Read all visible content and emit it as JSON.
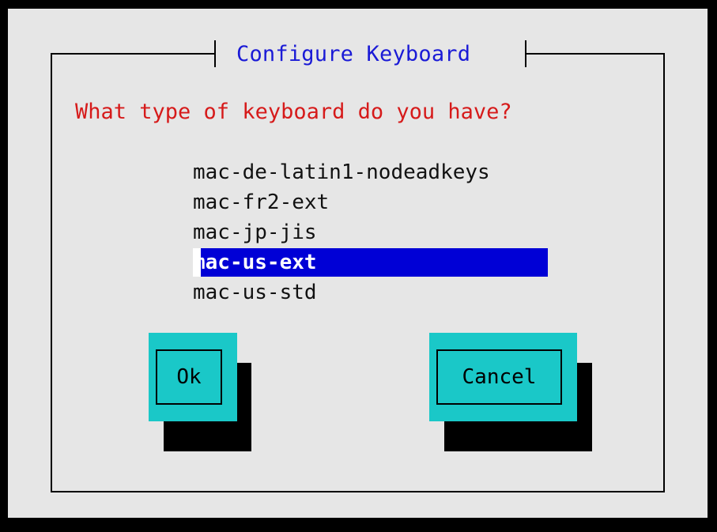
{
  "dialog": {
    "title": "Configure Keyboard",
    "prompt": "What type of keyboard do you have?"
  },
  "keyboards": {
    "items": [
      "mac-de-latin1-nodeadkeys",
      "mac-fr2-ext",
      "mac-jp-jis",
      "mac-us-ext",
      "mac-us-std"
    ],
    "selected": "mac-us-ext"
  },
  "buttons": {
    "ok_label": "Ok",
    "cancel_label": "Cancel"
  },
  "colors": {
    "background": "#000000",
    "dialog": "#e6e6e6",
    "title": "#1a1ad6",
    "prompt": "#d61a1a",
    "selection": "#0000d6",
    "button": "#1ac8c8"
  }
}
